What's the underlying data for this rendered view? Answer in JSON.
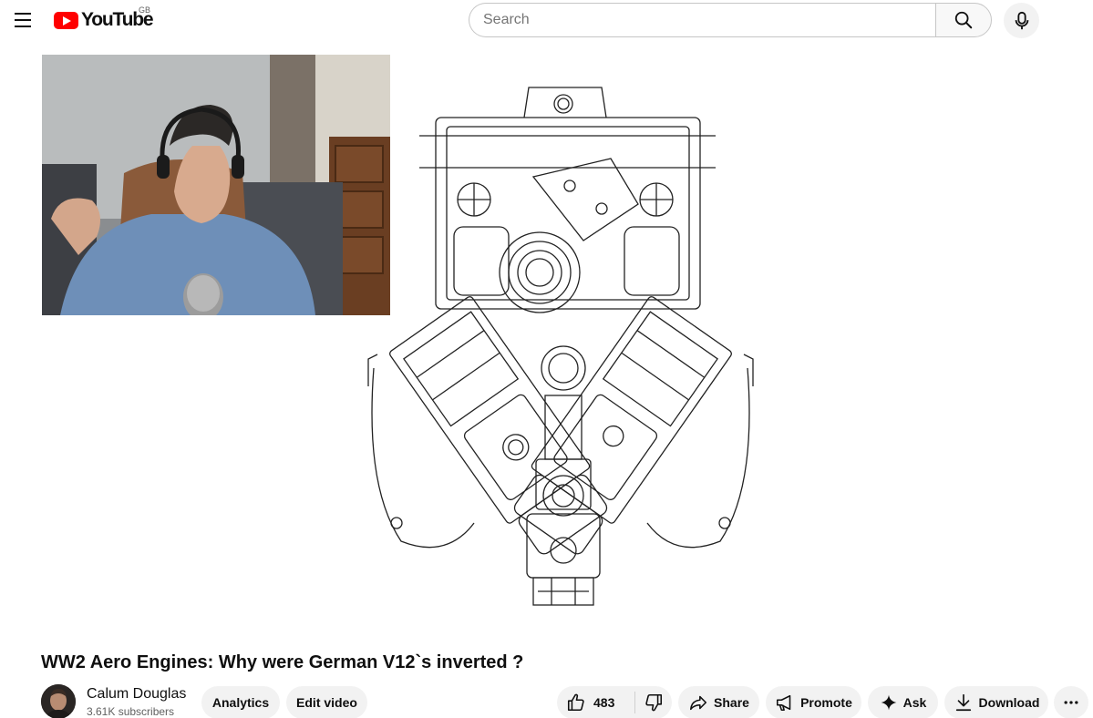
{
  "masthead": {
    "logo_text": "YouTube",
    "country_code": "GB",
    "search_placeholder": "Search"
  },
  "icons": {
    "menu": "hamburger-menu-icon",
    "search": "search-icon",
    "mic": "microphone-icon",
    "like": "thumbs-up-icon",
    "dislike": "thumbs-down-icon",
    "share": "share-arrow-icon",
    "promote": "megaphone-icon",
    "ask": "sparkle-icon",
    "download": "download-icon",
    "more": "more-horizontal-icon"
  },
  "colors": {
    "brand_red": "#ff0000",
    "button_bg": "#f2f2f2",
    "text_primary": "#0f0f0f",
    "text_secondary": "#606060"
  },
  "video": {
    "title": "WW2 Aero Engines: Why were German V12`s inverted ?",
    "frame_content": "webcam-inset-and-engine-cross-section-drawing"
  },
  "channel": {
    "name": "Calum Douglas",
    "subscribers": "3.61K subscribers"
  },
  "actions": {
    "analytics_label": "Analytics",
    "edit_video_label": "Edit video",
    "like_count": "483",
    "share_label": "Share",
    "promote_label": "Promote",
    "ask_label": "Ask",
    "download_label": "Download"
  }
}
